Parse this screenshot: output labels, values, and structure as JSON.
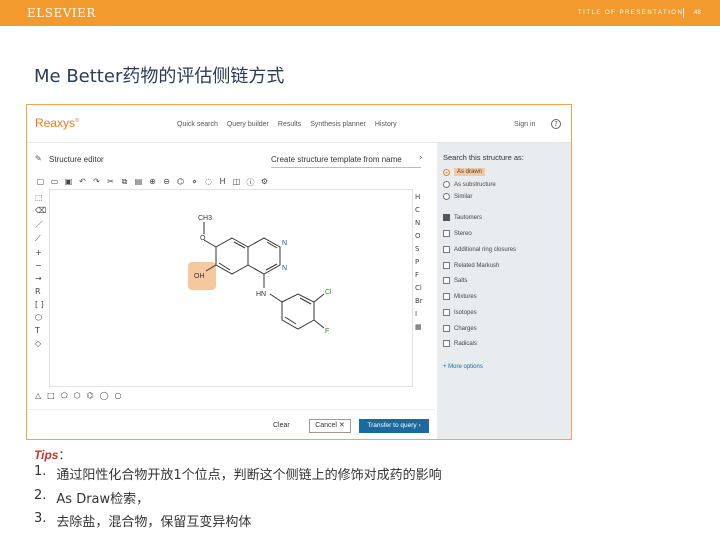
{
  "header": {
    "logo": "ELSEVIER",
    "presentation_title": "TITLE OF PRESENTATION",
    "page_number": "48",
    "bar_color": "#f29a2e"
  },
  "slide_title": "Me Better药物的评估侧链方式",
  "app": {
    "brand": "Reaxys",
    "brand_tm": "®",
    "nav": [
      "Quick search",
      "Query builder",
      "Results",
      "Synthesis planner",
      "History"
    ],
    "signin": "Sign in",
    "help_icon": "?",
    "editor_title": "Structure editor",
    "template_label": "Create structure template from name",
    "structure_labels": {
      "ch3": "CH3",
      "o": "O",
      "oh": "OH",
      "n1": "N",
      "n2": "N",
      "hn": "HN",
      "cl": "Cl",
      "f": "F"
    },
    "footer": {
      "clear": "Clear",
      "cancel": "Cancel",
      "transfer": "Transfer to query"
    },
    "panel": {
      "title": "Search this structure as:",
      "radio_options": [
        {
          "label": "As drawn",
          "selected": true
        },
        {
          "label": "As substructure",
          "selected": false
        },
        {
          "label": "Similar",
          "selected": false
        }
      ],
      "check_options": [
        {
          "label": "Tautomers",
          "checked": true
        },
        {
          "label": "Stereo",
          "checked": false
        },
        {
          "label": "Additional ring closures",
          "checked": false
        },
        {
          "label": "Related Markush",
          "checked": false
        },
        {
          "label": "Salts",
          "checked": false
        },
        {
          "label": "Mixtures",
          "checked": false
        },
        {
          "label": "Isotopes",
          "checked": false
        },
        {
          "label": "Charges",
          "checked": false
        },
        {
          "label": "Radicals",
          "checked": false
        }
      ],
      "more_options": "+ More options"
    },
    "accent_color": "#f07a1e",
    "button_color": "#1a6aa0"
  },
  "tips": {
    "label": "Tips",
    "colon": "：",
    "items": [
      {
        "num": "1.",
        "text": "通过阳性化合物开放1个位点，判断这个侧链上的修饰对成药的影响"
      },
      {
        "num": "2.",
        "text": "As Draw检索，"
      },
      {
        "num": "3.",
        "text": "去除盐，混合物，保留互变异构体"
      }
    ],
    "label_color": "#c0392b"
  }
}
